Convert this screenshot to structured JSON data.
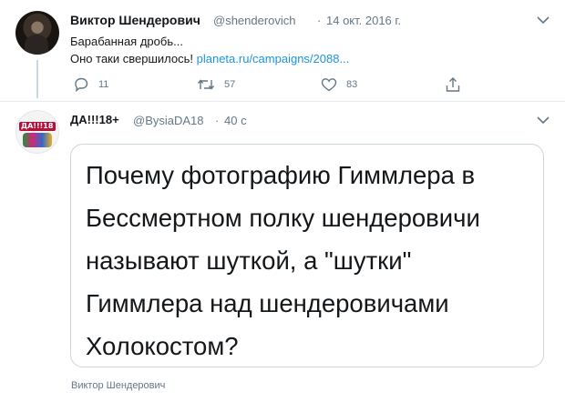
{
  "tweet1": {
    "author_name": "Виктор Шендерович",
    "handle": "@shenderovich",
    "separator": "·",
    "date": "14 окт. 2016 г.",
    "text_line1": "Барабанная дробь...",
    "text_line2_prefix": "Оно таки свершилось!",
    "link_text": "planeta.ru/campaigns/2088...",
    "replies": "11",
    "retweets": "57",
    "likes": "83"
  },
  "tweet2": {
    "author_name": "ДА!!!18+",
    "handle": "@BysiaDA18",
    "separator": "·",
    "time": "40 с",
    "avatar_text": "ДА!!!18",
    "quote_lines": [
      "Почему фотографию Гиммлера в",
      "Бессмертном полку шендеровичи",
      "называют шуткой, а \"шутки\"",
      "Гиммлера над шендеровичами",
      "Холокостом?"
    ]
  },
  "footer_text": "Виктор Шендерович",
  "colors": {
    "link": "#1b95e0",
    "secondary_text": "#657786",
    "divider": "#e6ecf0",
    "border": "#ccd6dd"
  }
}
